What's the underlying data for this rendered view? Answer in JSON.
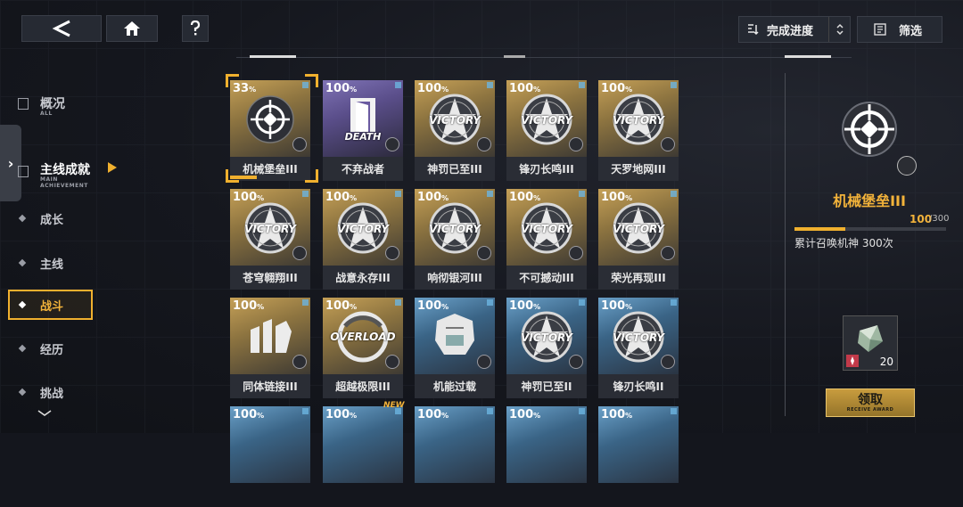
{
  "topbar": {
    "sort_label": "完成进度",
    "filter_label": "筛选"
  },
  "nav": {
    "items": [
      {
        "label": "概况",
        "sub": "ALL"
      },
      {
        "label": "主线成就",
        "sub": "MAIN ACHIEVEMENT"
      },
      {
        "label": "成长"
      },
      {
        "label": "主线"
      },
      {
        "label": "战斗"
      },
      {
        "label": "经历"
      },
      {
        "label": "挑战"
      }
    ],
    "active": "战斗"
  },
  "cards": [
    {
      "percent": "33",
      "name": "机械堡垒III",
      "theme": "gold",
      "emblem": "crosshair",
      "selected": true
    },
    {
      "percent": "100",
      "name": "不弃战者",
      "theme": "purple",
      "emblem": "death"
    },
    {
      "percent": "100",
      "name": "神罚已至III",
      "theme": "gold",
      "emblem": "victory"
    },
    {
      "percent": "100",
      "name": "锋刃长鸣III",
      "theme": "gold",
      "emblem": "victory"
    },
    {
      "percent": "100",
      "name": "天罗地网III",
      "theme": "gold",
      "emblem": "victory"
    },
    {
      "percent": "100",
      "name": "苍穹翱翔III",
      "theme": "gold",
      "emblem": "victory"
    },
    {
      "percent": "100",
      "name": "战意永存III",
      "theme": "gold",
      "emblem": "victory"
    },
    {
      "percent": "100",
      "name": "响彻银河III",
      "theme": "gold",
      "emblem": "victory"
    },
    {
      "percent": "100",
      "name": "不可撼动III",
      "theme": "gold",
      "emblem": "victory"
    },
    {
      "percent": "100",
      "name": "荣光再现III",
      "theme": "gold",
      "emblem": "victory"
    },
    {
      "percent": "100",
      "name": "同体链接III",
      "theme": "gold",
      "emblem": "link"
    },
    {
      "percent": "100",
      "name": "超越极限III",
      "theme": "gold",
      "emblem": "overload"
    },
    {
      "percent": "100",
      "name": "机能过载",
      "theme": "blue",
      "emblem": "armor"
    },
    {
      "percent": "100",
      "name": "神罚已至II",
      "theme": "blue",
      "emblem": "victory"
    },
    {
      "percent": "100",
      "name": "锋刃长鸣II",
      "theme": "blue",
      "emblem": "victory"
    },
    {
      "percent": "100",
      "name": "",
      "theme": "blue",
      "emblem": "none"
    },
    {
      "percent": "100",
      "name": "",
      "theme": "blue",
      "emblem": "none",
      "new": true
    },
    {
      "percent": "100",
      "name": "",
      "theme": "blue",
      "emblem": "none"
    },
    {
      "percent": "100",
      "name": "",
      "theme": "blue",
      "emblem": "none"
    },
    {
      "percent": "100",
      "name": "",
      "theme": "blue",
      "emblem": "none"
    }
  ],
  "emblem_text": {
    "victory": "VICTORY",
    "death": "DEATH",
    "overload": "OVERLOAD",
    "new": "NEW",
    "percent_sign": "%"
  },
  "detail": {
    "title": "机械堡垒III",
    "progress_current": "100",
    "progress_total": "/300",
    "progress_fraction": 0.333,
    "description": "累计召唤机神 300次",
    "reward_count": "20",
    "claim_label": "领取",
    "claim_sub": "RECEIVE AWARD"
  },
  "colors": {
    "accent": "#f0b02e",
    "gold_card": "#b08d4a",
    "blue_card": "#4f7fa6",
    "purple_card": "#6c61a0"
  }
}
